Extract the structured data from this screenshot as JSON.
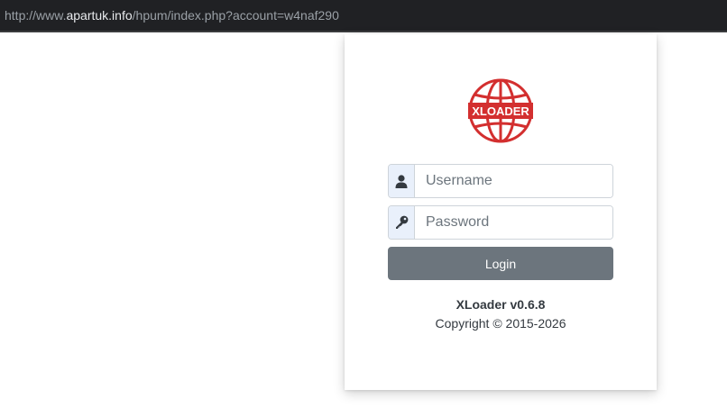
{
  "browser": {
    "url_prefix": "http://www.",
    "url_host": "apartuk.info",
    "url_path": "/hpum/index.php?account=w4naf290"
  },
  "logo": {
    "text": "XLOADER",
    "icon": "globe-icon",
    "color": "#d32f2f"
  },
  "form": {
    "username_placeholder": "Username",
    "username_icon": "user-icon",
    "password_placeholder": "Password",
    "password_icon": "key-icon",
    "login_label": "Login",
    "button_color": "#6c757d"
  },
  "footer": {
    "product": "XLoader v0.6.8",
    "copyright": "Copyright © 2015-2026"
  }
}
